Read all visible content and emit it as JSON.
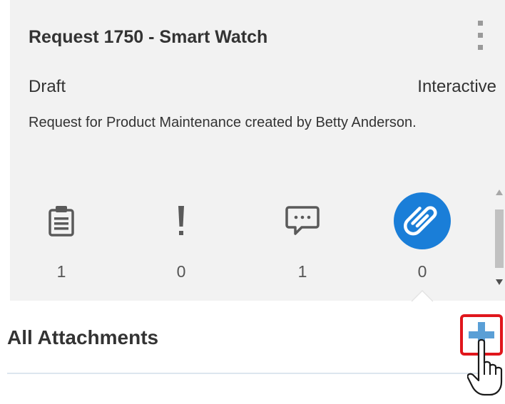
{
  "request": {
    "title": "Request 1750 - Smart Watch",
    "status": "Draft",
    "mode": "Interactive",
    "description": "Request for Product Maintenance created by Betty Anderson."
  },
  "stats": [
    {
      "icon": "clipboard-icon",
      "count": "1",
      "active": false
    },
    {
      "icon": "exclamation-icon",
      "count": "0",
      "active": false
    },
    {
      "icon": "comment-icon",
      "count": "1",
      "active": false
    },
    {
      "icon": "paperclip-icon",
      "count": "0",
      "active": true
    }
  ],
  "attachments": {
    "title": "All Attachments"
  },
  "colors": {
    "accent": "#1a7ed8",
    "highlight": "#e0161c",
    "add_icon": "#5a9fd6"
  }
}
